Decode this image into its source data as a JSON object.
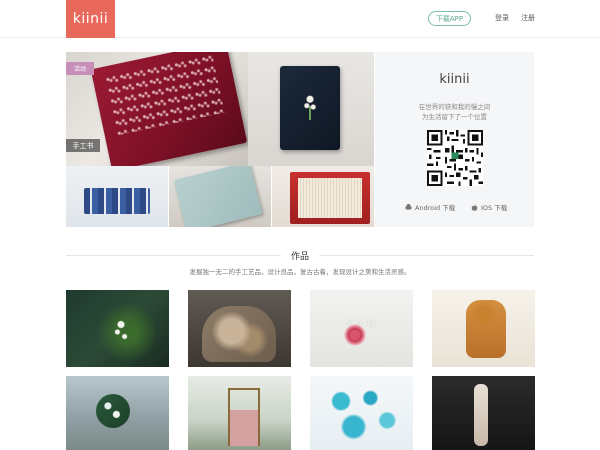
{
  "header": {
    "logo_text": "kiinii",
    "app_button_label": "下载APP",
    "login_label": "登录",
    "register_label": "注册"
  },
  "hero": {
    "tag_label": "活动",
    "category_label": "手工书",
    "qr_panel": {
      "title": "kiinii",
      "line1": "在世界的铁和我的慢之间",
      "line2": "为生活留下了一个位置",
      "android_label": "Android 下载",
      "ios_label": "IOS 下载"
    }
  },
  "works_section": {
    "title": "作品",
    "subtitle": "发掘独一无二的手工艺品，设计良品，复古古着，发现设计之美和生活灵感。"
  },
  "gallery": {
    "watermark_text": "YAN"
  },
  "colors": {
    "brand": "#e8685c",
    "accent_green": "#5aa88c"
  }
}
